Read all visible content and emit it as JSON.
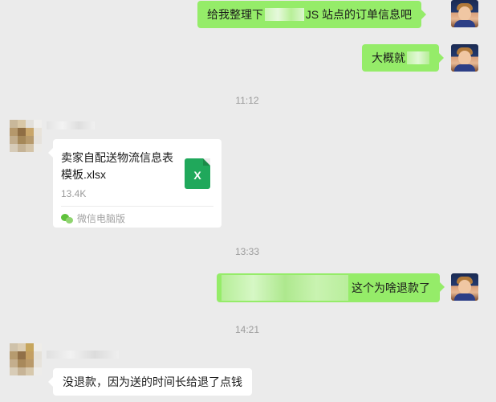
{
  "messages": {
    "m1": {
      "text_a": "给我整理下",
      "text_b": "JS 站点的订单信息吧"
    },
    "m2": {
      "text_a": "大概就"
    },
    "t1": "11:12",
    "file": {
      "name": "卖家自配送物流信息表模板.xlsx",
      "size": "13.4K",
      "source": "微信电脑版",
      "icon_letter": "X",
      "icon": "excel-file-icon"
    },
    "t2": "13:33",
    "m3": {
      "text": "这个为啥退款了"
    },
    "t3": "14:21",
    "m4": {
      "text": "没退款，因为送的时间长给退了点钱"
    }
  },
  "colors": {
    "background": "#ebebeb",
    "outgoing_bubble": "#95ec69",
    "incoming_bubble": "#ffffff",
    "timestamp": "#9b9b9b",
    "excel_green": "#20a85b"
  }
}
